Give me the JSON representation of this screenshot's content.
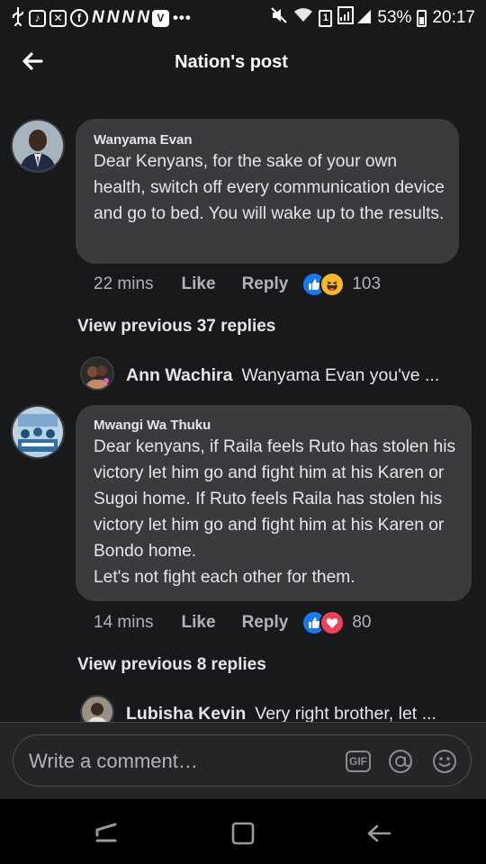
{
  "status_bar": {
    "battery": "53%",
    "time": "20:17",
    "sim": "1",
    "icons": [
      "usb-icon",
      "tiktok-icon",
      "message-icon",
      "facebook-icon",
      "n-app-icon",
      "n-app-icon",
      "n-app-icon",
      "n-app-icon",
      "v-app-icon",
      "more-icon",
      "mute-icon",
      "wifi-icon",
      "sim-icon",
      "signal-icon",
      "battery-icon"
    ]
  },
  "header": {
    "title": "Nation's post"
  },
  "comments": [
    {
      "author": "Wanyama Evan",
      "text": "Dear Kenyans, for the sake of your own health, switch off every communication device and go to bed. You will wake up to the results.",
      "time": "22 mins",
      "like_label": "Like",
      "reply_label": "Reply",
      "reactions": [
        "like",
        "haha"
      ],
      "reaction_count": "103",
      "view_previous": "View previous 37 replies",
      "latest_reply": {
        "name": "Ann Wachira",
        "text": "Wanyama Evan you've ..."
      }
    },
    {
      "author": "Mwangi Wa Thuku",
      "text": "Dear kenyans, if Raila feels Ruto has stolen his victory let him go and fight him at his Karen or Sugoi home. If Ruto feels Raila has stolen his victory let him go and fight him at his Karen or Bondo home.\nLet's not fight each other for them.",
      "time": "14 mins",
      "like_label": "Like",
      "reply_label": "Reply",
      "reactions": [
        "like",
        "love"
      ],
      "reaction_count": "80",
      "view_previous": "View previous 8 replies",
      "latest_reply": {
        "name": "Lubisha Kevin",
        "text": "Very right brother, let ..."
      }
    }
  ],
  "composer": {
    "placeholder": "Write a comment…",
    "gif_label": "GIF"
  },
  "colors": {
    "background": "#18191a",
    "bubble": "#3a3b3c",
    "like_blue": "#1877f2",
    "love_red": "#f33e58",
    "haha_yellow": "#f7b928"
  }
}
